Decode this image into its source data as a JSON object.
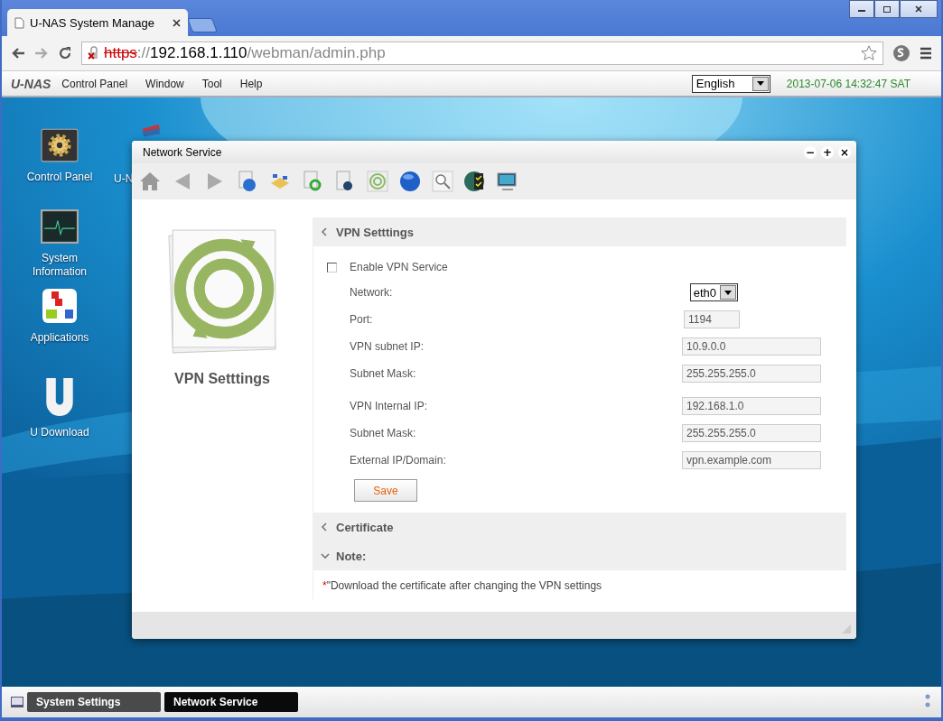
{
  "browser": {
    "tab_title": "U-NAS System Manage",
    "url": {
      "scheme": "https",
      "separator": "://",
      "host": "192.168.1.110",
      "path": "/webman/admin.php",
      "insecure": true
    }
  },
  "menu_bar": {
    "logo": "U-NAS",
    "items": [
      "Control Panel",
      "Window",
      "Tool",
      "Help"
    ],
    "language": "English",
    "datetime": "2013-07-06 14:32:47 SAT"
  },
  "desktop_icons": [
    {
      "label": "Control Panel",
      "kind": "gear"
    },
    {
      "label": "U-N",
      "kind": "books"
    },
    {
      "label": "System Information",
      "kind": "monitor"
    },
    {
      "label": "Applications",
      "kind": "apps"
    },
    {
      "label": "U Download",
      "kind": "u"
    }
  ],
  "window": {
    "title": "Network Service",
    "controls": [
      "−",
      "+",
      "×"
    ],
    "toolbar": [
      {
        "kind": "home"
      },
      {
        "kind": "back"
      },
      {
        "kind": "forward"
      },
      {
        "kind": "doc-globe"
      },
      {
        "kind": "network"
      },
      {
        "kind": "doc-refresh"
      },
      {
        "kind": "doc-e"
      },
      {
        "kind": "rings"
      },
      {
        "kind": "globe"
      },
      {
        "kind": "magnifier"
      },
      {
        "kind": "checklist"
      },
      {
        "kind": "monitor"
      }
    ],
    "sidebar": {
      "title": "VPN Setttings"
    },
    "sections": [
      {
        "title": "VPN Setttings",
        "expanded": false,
        "kind": "form"
      },
      {
        "title": "Certificate",
        "expanded": false,
        "kind": "header"
      },
      {
        "title": "Note:",
        "expanded": true,
        "kind": "note"
      }
    ],
    "form": {
      "enable": {
        "label": "Enable VPN Service",
        "checked": false
      },
      "fields": [
        {
          "label": "Network:",
          "kind": "select",
          "value": "eth0"
        },
        {
          "label": "Port:",
          "kind": "short",
          "value": "1194"
        },
        {
          "label": "VPN subnet IP:",
          "kind": "text",
          "value": "10.9.0.0"
        },
        {
          "label": "Subnet Mask:",
          "kind": "text",
          "value": "255.255.255.0"
        },
        {
          "label": "VPN Internal IP:",
          "kind": "text",
          "value": "192.168.1.0"
        },
        {
          "label": "Subnet Mask:",
          "kind": "text",
          "value": "255.255.255.0"
        },
        {
          "label": "External IP/Domain:",
          "kind": "text",
          "value": "vpn.example.com"
        }
      ],
      "save": "Save"
    },
    "note": {
      "marker": "*",
      "text": "\"Download the certificate after changing the VPN settings"
    }
  },
  "taskbar": [
    {
      "label": "System Settings",
      "selected": false
    },
    {
      "label": "Network Service",
      "selected": true
    }
  ]
}
